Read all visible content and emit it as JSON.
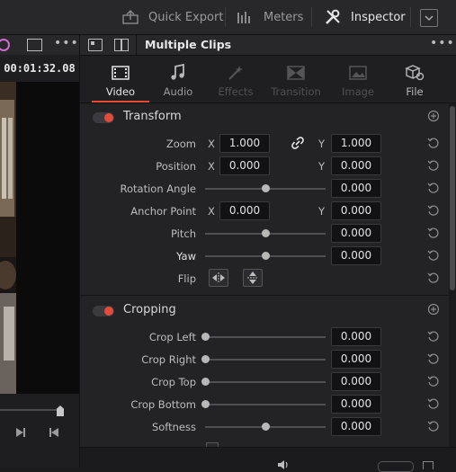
{
  "topbar": {
    "quick_export": "Quick Export",
    "meters": "Meters",
    "inspector": "Inspector"
  },
  "viewer": {
    "timecode": "00:01:32.08"
  },
  "inspector": {
    "title": "Multiple Clips",
    "tabs": [
      {
        "label": "Video",
        "active": true,
        "icon": "film-icon"
      },
      {
        "label": "Audio",
        "active": false,
        "icon": "music-note-icon"
      },
      {
        "label": "Effects",
        "active": false,
        "icon": "magic-wand-icon"
      },
      {
        "label": "Transition",
        "active": false,
        "icon": "transition-icon"
      },
      {
        "label": "Image",
        "active": false,
        "icon": "image-icon"
      },
      {
        "label": "File",
        "active": false,
        "icon": "file-icon"
      }
    ],
    "transform": {
      "title": "Transform",
      "zoom": {
        "label": "Zoom",
        "x_axis": "X",
        "x": "1.000",
        "y_axis": "Y",
        "y": "1.000"
      },
      "position": {
        "label": "Position",
        "x_axis": "X",
        "x": "0.000",
        "y_axis": "Y",
        "y": "0.000"
      },
      "rotation": {
        "label": "Rotation Angle",
        "value": "0.000",
        "level": 0.5
      },
      "anchor": {
        "label": "Anchor Point",
        "x_axis": "X",
        "x": "0.000",
        "y_axis": "Y",
        "y": "0.000"
      },
      "pitch": {
        "label": "Pitch",
        "value": "0.000",
        "level": 0.5
      },
      "yaw": {
        "label": "Yaw",
        "value": "0.000",
        "level": 0.5
      },
      "flip": {
        "label": "Flip"
      }
    },
    "cropping": {
      "title": "Cropping",
      "crop_left": {
        "label": "Crop Left",
        "value": "0.000",
        "level": 0
      },
      "crop_right": {
        "label": "Crop Right",
        "value": "0.000",
        "level": 0
      },
      "crop_top": {
        "label": "Crop Top",
        "value": "0.000",
        "level": 0
      },
      "crop_bottom": {
        "label": "Crop Bottom",
        "value": "0.000",
        "level": 0
      },
      "softness": {
        "label": "Softness",
        "value": "0.000",
        "level": 0.5
      }
    }
  },
  "colors": {
    "accent_red": "#e44c3a",
    "background": "#1b1b1e",
    "panel": "#232326"
  }
}
